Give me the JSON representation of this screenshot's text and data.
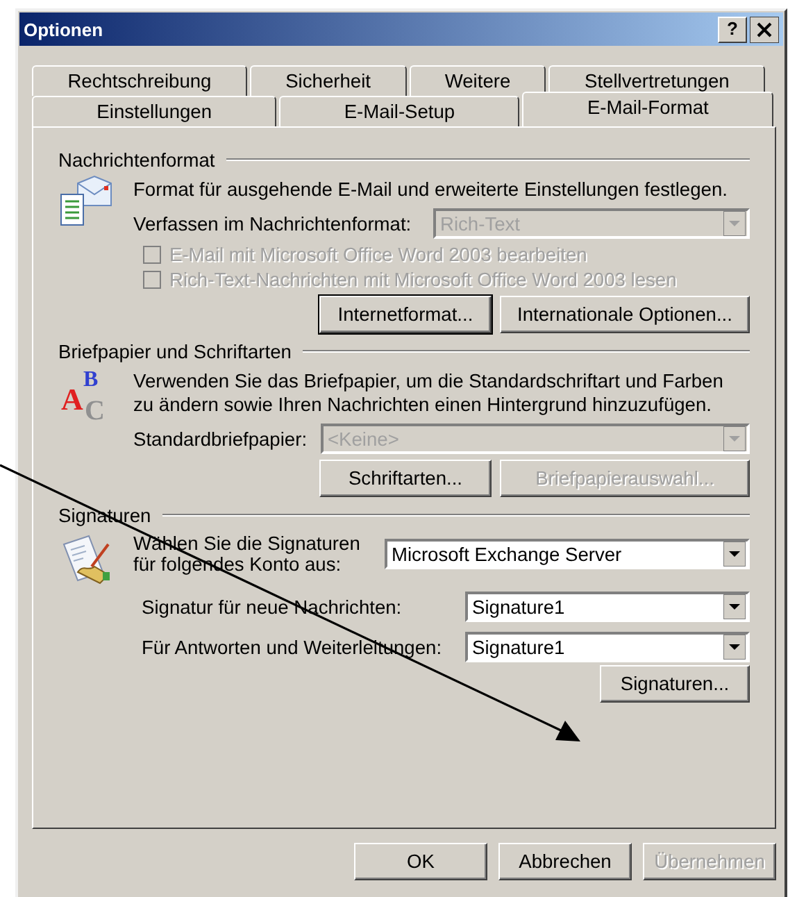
{
  "window": {
    "title": "Optionen",
    "help_button": "?"
  },
  "tab_rows": [
    [
      {
        "label": "Rechtschreibung",
        "selected": false
      },
      {
        "label": "Sicherheit",
        "selected": false
      },
      {
        "label": "Weitere",
        "selected": false
      },
      {
        "label": "Stellvertretungen",
        "selected": false
      }
    ],
    [
      {
        "label": "Einstellungen",
        "selected": false
      },
      {
        "label": "E-Mail-Setup",
        "selected": false
      },
      {
        "label": "E-Mail-Format",
        "selected": true
      }
    ]
  ],
  "message_format": {
    "title": "Nachrichtenformat",
    "description": "Format für ausgehende E-Mail und erweiterte Einstellungen festlegen.",
    "format_label": "Verfassen im Nachrichtenformat:",
    "format_combo": {
      "value": "Rich-Text",
      "disabled": true
    },
    "checkboxes": [
      {
        "label": "E-Mail mit Microsoft Office Word 2003 bearbeiten",
        "checked": false,
        "disabled": true
      },
      {
        "label": "Rich-Text-Nachrichten mit Microsoft Office Word 2003 lesen",
        "checked": false,
        "disabled": true
      }
    ],
    "buttons": [
      {
        "label": "Internetformat...",
        "default": true,
        "disabled": false
      },
      {
        "label": "Internationale Optionen...",
        "default": false,
        "disabled": false
      }
    ]
  },
  "stationery": {
    "title": "Briefpapier und Schriftarten",
    "icon_letters": [
      "B",
      "A",
      "C"
    ],
    "description": "Verwenden Sie das Briefpapier, um die Standardschriftart und Farben\nzu ändern sowie Ihren Nachrichten einen Hintergrund hinzuzufügen.",
    "stationery_label": "Standardbriefpapier:",
    "stationery_combo": {
      "value": "<Keine>",
      "disabled": true
    },
    "buttons": [
      {
        "label": "Schriftarten...",
        "default": false,
        "disabled": false
      },
      {
        "label": "Briefpapierauswahl...",
        "default": false,
        "disabled": true
      }
    ]
  },
  "signatures": {
    "title": "Signaturen",
    "account_label": "Wählen Sie die Signaturen\nfür folgendes Konto aus:",
    "account_combo": {
      "value": "Microsoft Exchange Server",
      "disabled": false
    },
    "rows": [
      {
        "label": "Signatur für neue Nachrichten:",
        "combo": {
          "value": "Signature1",
          "disabled": false
        }
      },
      {
        "label": "Für Antworten und Weiterleitungen:",
        "combo": {
          "value": "Signature1",
          "disabled": false
        }
      }
    ],
    "button": {
      "label": "Signaturen...",
      "default": false,
      "disabled": false
    }
  },
  "footer_buttons": [
    {
      "label": "OK",
      "default": false,
      "disabled": false
    },
    {
      "label": "Abbrechen",
      "default": false,
      "disabled": false
    },
    {
      "label": "Übernehmen",
      "default": false,
      "disabled": true
    }
  ]
}
